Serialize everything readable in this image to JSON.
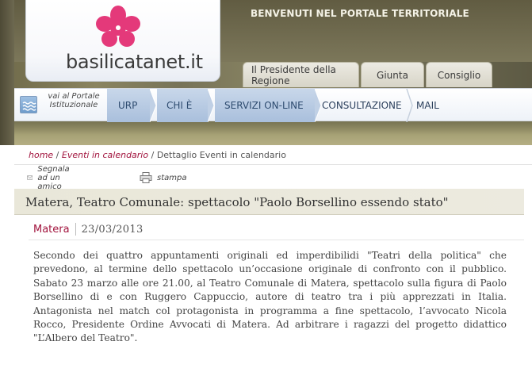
{
  "header": {
    "welcome": "BENVENUTI NEL PORTALE TERRITORIALE",
    "logo_text": "basilicatanet.it",
    "top_tabs": [
      "Il Presidente della Regione",
      "Giunta",
      "Consiglio"
    ],
    "colors": {
      "flower": "#e4397a",
      "nav_active": "#b9cbe3",
      "link": "#a2143e"
    }
  },
  "nav": {
    "portal_link": "vai al Portale Istituzionale",
    "items": [
      "URP",
      "CHI È",
      "SERVIZI ON-LINE",
      "CONSULTAZIONE",
      "MAIL"
    ]
  },
  "breadcrumb": {
    "home": "home",
    "sep1": " / ",
    "events": "Eventi in calendario",
    "sep2": " / ",
    "current": "Dettaglio Eventi in calendario"
  },
  "tools": {
    "report": "Segnala ad un amico",
    "print": "stampa"
  },
  "article": {
    "title": "Matera, Teatro Comunale: spettacolo \"Paolo Borsellino essendo stato\"",
    "place": "Matera",
    "date": "23/03/2013",
    "body": "Secondo dei quattro appuntamenti originali ed imperdibilidi \"Teatri della politica\" che prevedono, al termine dello spettacolo un’occasione originale di confronto con il pubblico. Sabato 23 marzo alle ore 21.00, al Teatro Comunale di Matera, spettacolo sulla figura di Paolo Borsellino di e con Ruggero Cappuccio, autore di teatro tra i più apprezzati in Italia. Antagonista nel match col protagonista in programma a fine spettacolo, l’avvocato Nicola Rocco, Presidente Ordine Avvocati di Matera. Ad arbitrare i ragazzi del progetto didattico \"L’Albero del Teatro\"."
  }
}
